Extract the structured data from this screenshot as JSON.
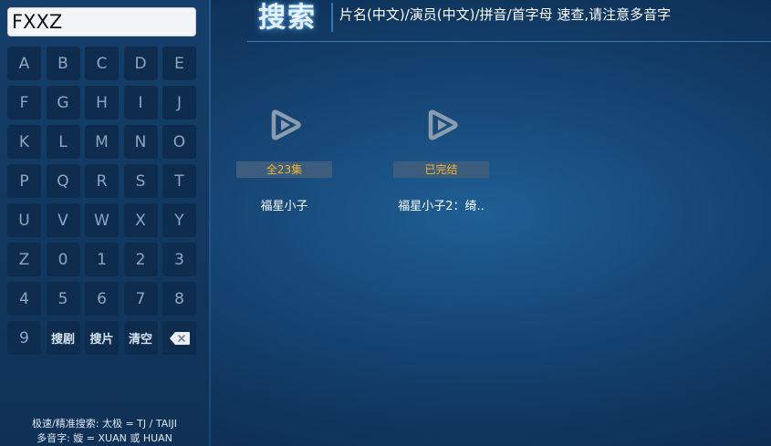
{
  "search": {
    "value": "FXXZ"
  },
  "keypad": {
    "keys": [
      "A",
      "B",
      "C",
      "D",
      "E",
      "F",
      "G",
      "H",
      "I",
      "J",
      "K",
      "L",
      "M",
      "N",
      "O",
      "P",
      "Q",
      "R",
      "S",
      "T",
      "U",
      "V",
      "W",
      "X",
      "Y",
      "Z",
      "0",
      "1",
      "2",
      "3",
      "4",
      "5",
      "6",
      "7",
      "8",
      "9"
    ],
    "search_drama": "搜剧",
    "search_movie": "搜片",
    "clear": "清空",
    "backspace_icon": "backspace-icon"
  },
  "hints": {
    "line1": "极速/精准搜索: 太极 = TJ / TAIJI",
    "line2": "多音字: 嫙 = XUAN 或 HUAN"
  },
  "header": {
    "title": "搜索",
    "hint": "片名(中文)/演员(中文)/拼音/首字母 速查,请注意多音字"
  },
  "results": [
    {
      "badge": "全23集",
      "title": "福星小子",
      "icon": "play-placeholder-icon"
    },
    {
      "badge": "已完结",
      "title": "福星小子2：绮..",
      "icon": "play-placeholder-icon"
    }
  ],
  "colors": {
    "badge_text": "#f2b632",
    "accent": "#2d79b8"
  }
}
